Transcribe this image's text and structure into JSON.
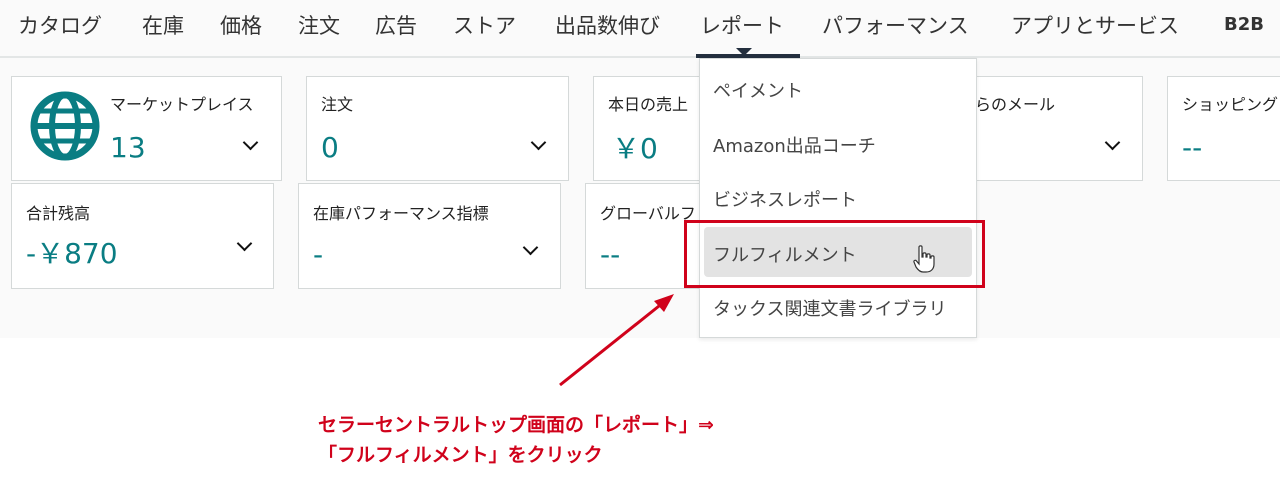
{
  "nav": {
    "items": [
      "カタログ",
      "在庫",
      "価格",
      "注文",
      "広告",
      "ストア",
      "出品数伸び",
      "レポート",
      "パフォーマンス",
      "アプリとサービス",
      "B2B"
    ]
  },
  "cards": {
    "marketplace": {
      "title": "マーケットプレイス",
      "value": "13"
    },
    "orders": {
      "title": "注文",
      "value": "0"
    },
    "today_sales": {
      "title": "本日の売上",
      "value": "￥0"
    },
    "messages": {
      "title": "らのメール"
    },
    "shopping": {
      "title": "ショッピング",
      "value": "--"
    },
    "balance": {
      "title": "合計残高",
      "value": "-￥870"
    },
    "inventory_performance": {
      "title": "在庫パフォーマンス指標",
      "value": "-"
    },
    "global": {
      "title": "グローバルフ",
      "value": "--"
    }
  },
  "dropdown": {
    "items": [
      "ペイメント",
      "Amazon出品コーチ",
      "ビジネスレポート",
      "フルフィルメント",
      "タックス関連文書ライブラリ"
    ]
  },
  "annotation": {
    "line1": "セラーセントラルトップ画面の「レポート」⇒",
    "line2": "「フルフィルメント」をクリック"
  },
  "colors": {
    "accent_teal": "#0a7d83",
    "annotation_red": "#d0021b",
    "nav_dark": "#232f3e"
  },
  "icons": [
    "globe-icon",
    "chevron-down-icon",
    "hand-cursor-icon"
  ]
}
